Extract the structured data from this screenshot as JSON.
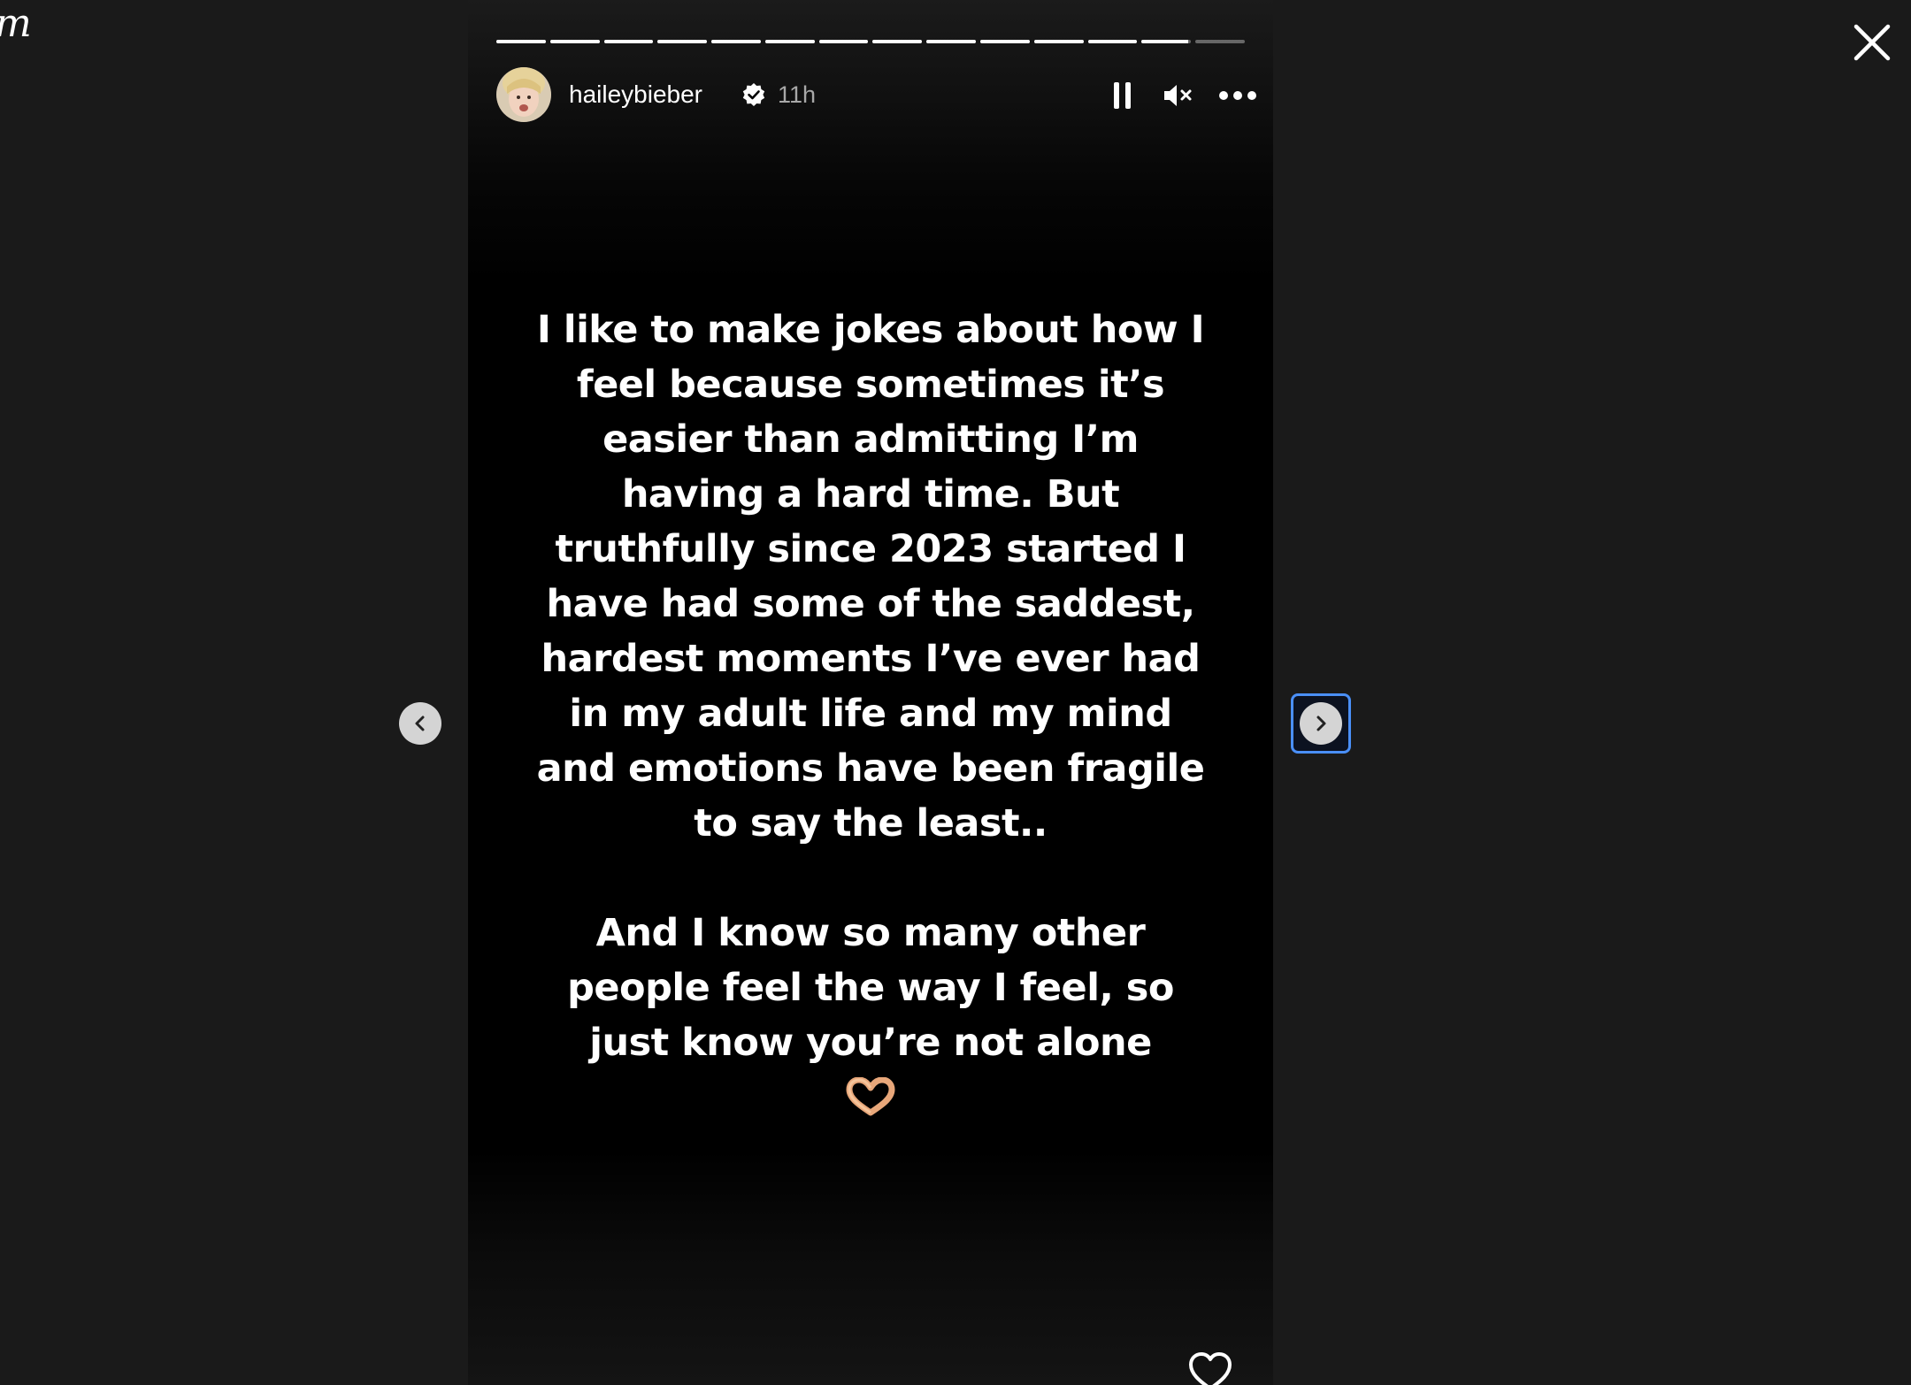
{
  "app": {
    "logo_fragment": "m"
  },
  "story": {
    "username": "haileybieber",
    "verified": true,
    "timestamp": "11h",
    "progress": {
      "segments_total": 14,
      "completed": 12,
      "current_fill": 0.95
    },
    "text_paragraph_1": [
      "I like to make jokes about how I",
      "feel because sometimes it’s",
      "easier than admitting I’m",
      "having a hard time. But",
      "truthfully since 2023 started I",
      "have had some of the saddest,",
      "hardest moments I’ve ever had",
      "in my adult life and my mind",
      "and emotions have been fragile",
      "to say the least.."
    ],
    "text_paragraph_2": [
      "And I know so many other",
      "people feel the way I feel, so",
      "just know you’re not alone"
    ],
    "emoji": "heart-hands"
  },
  "controls": {
    "pause_icon": "pause-icon",
    "mute_icon": "muted-speaker-icon",
    "more_icon": "more-options-icon",
    "close_icon": "close-icon",
    "like_icon": "heart-icon",
    "prev_icon": "chevron-left-icon",
    "next_icon": "chevron-right-icon"
  },
  "colors": {
    "page_background": "#1a1a1a",
    "story_background": "#000000",
    "text": "#ffffff",
    "timestamp": "#a8a8a8",
    "focus_ring": "#4a8ff7",
    "nav_button": "#d4d4d4"
  }
}
